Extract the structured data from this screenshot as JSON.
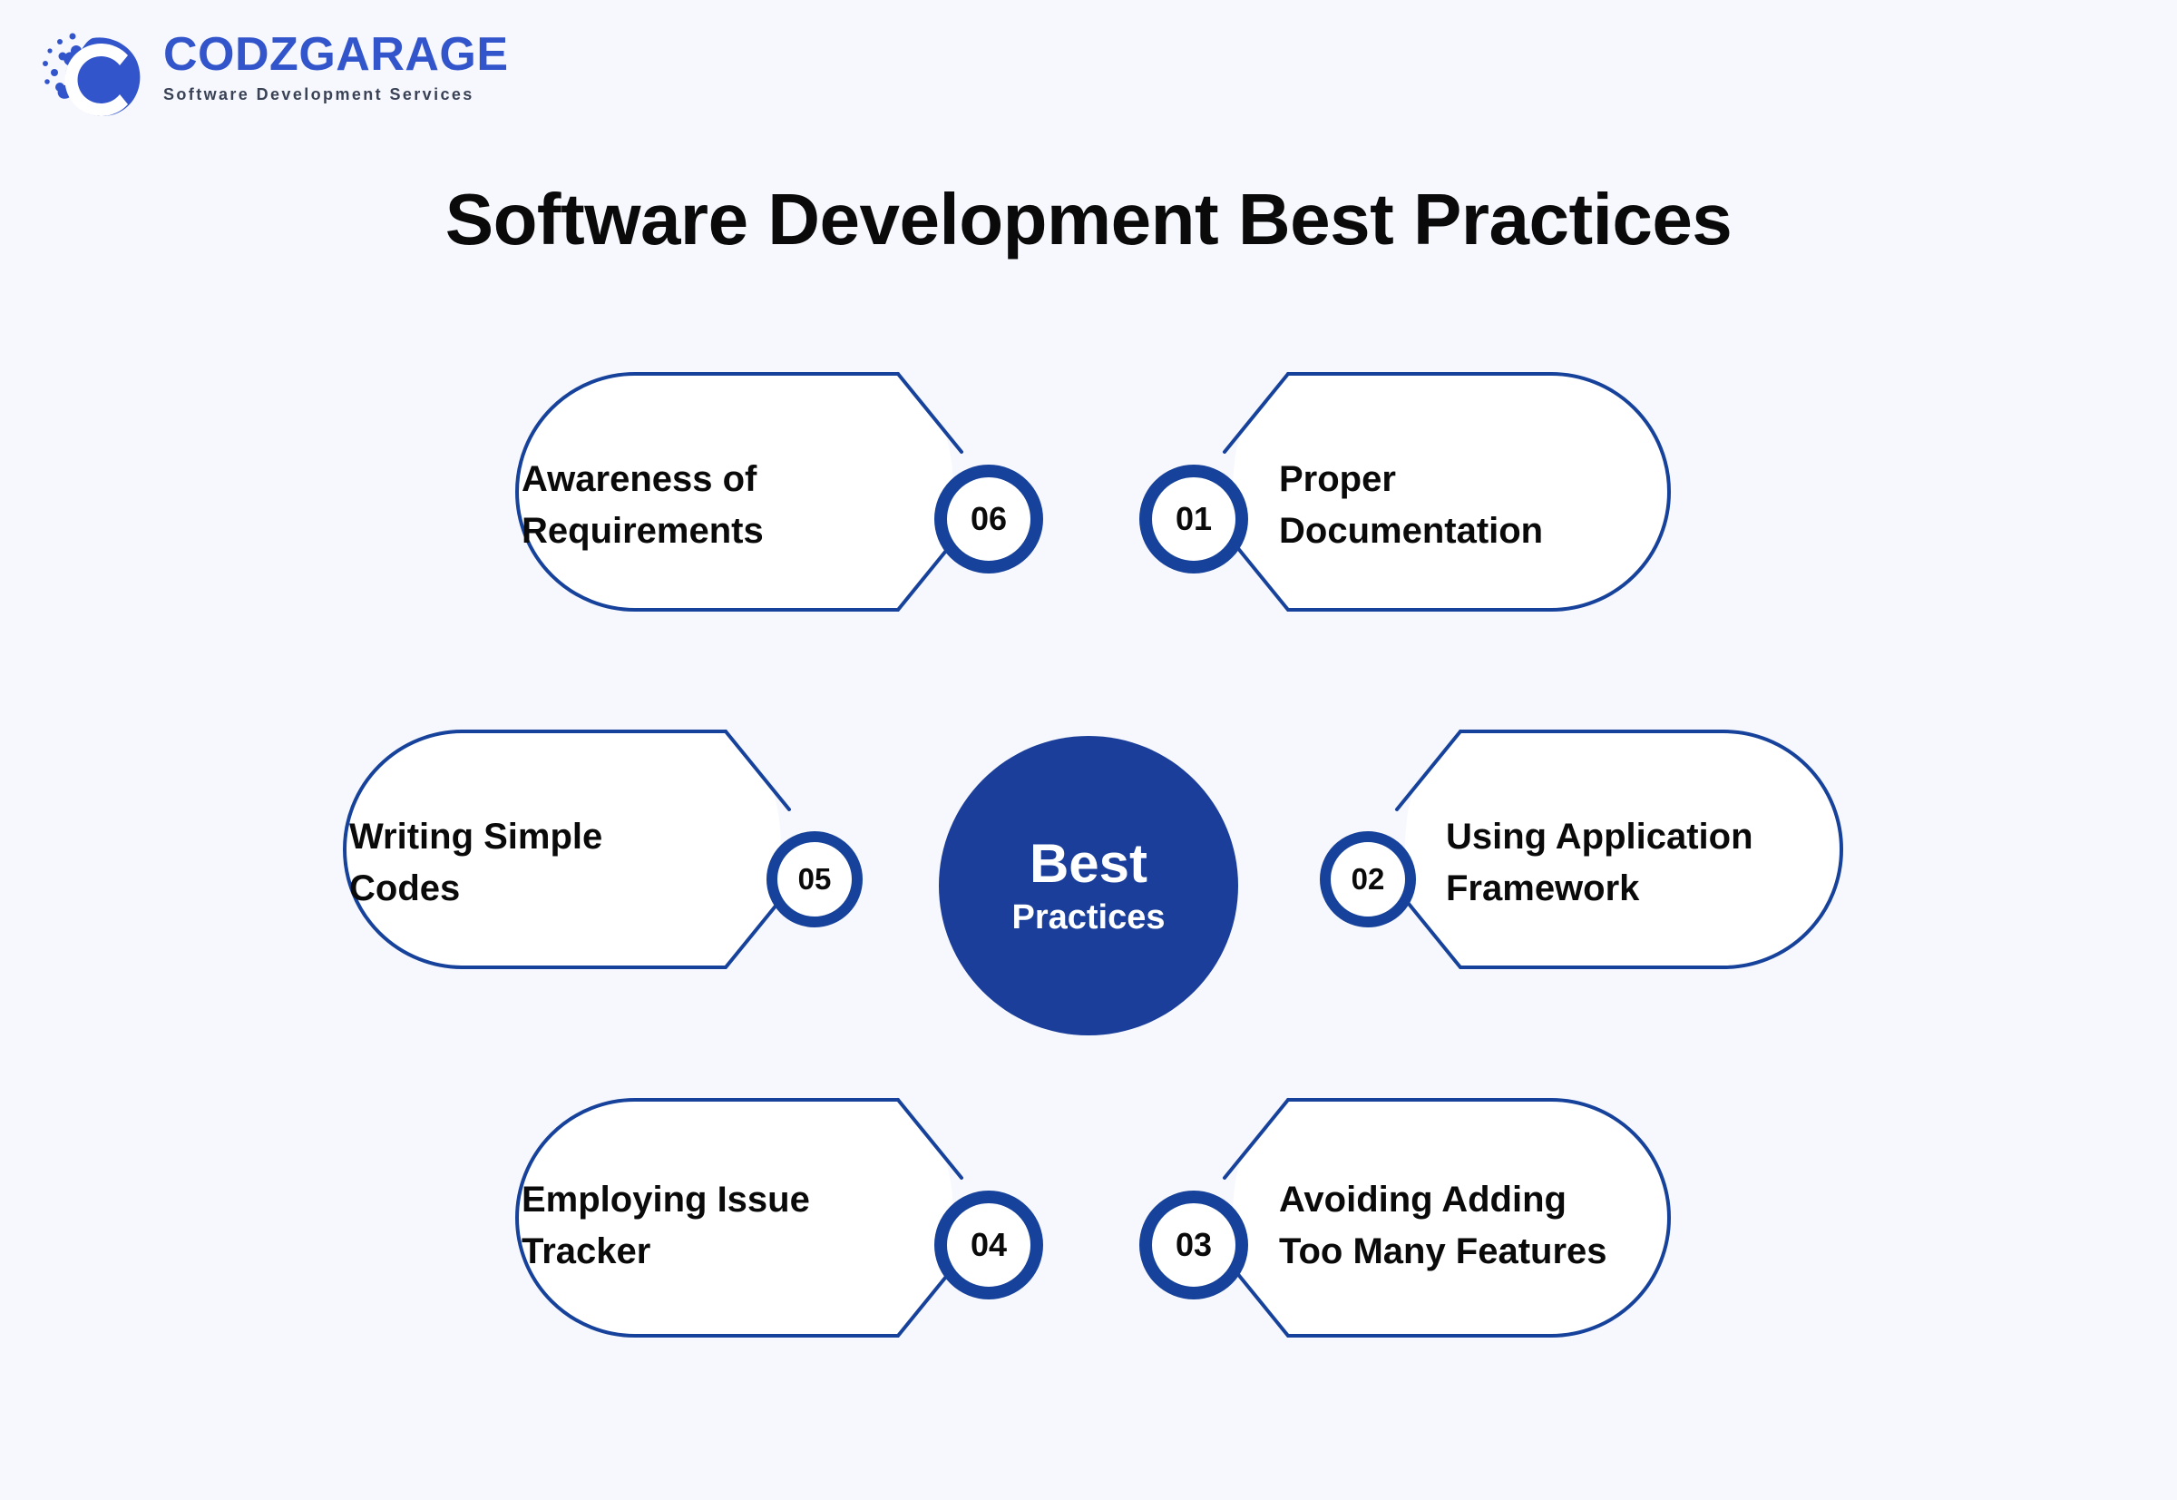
{
  "background_color": "#f6f8fd",
  "brand": {
    "logo_icon": "codzgarage-c-blob-icon",
    "wordmark": "CODZGARAGE",
    "tagline": "Software Development Services",
    "wordmark_color": "#3355cc",
    "tagline_color": "#3a4256"
  },
  "header": {
    "title": "Software Development Best Practices"
  },
  "center": {
    "title": "Best",
    "subtitle": "Practices",
    "fill_color": "#1a3e99",
    "text_color": "#ffffff"
  },
  "theme": {
    "card_border_color": "#17429b",
    "card_fill_color": "#ffffff",
    "badge_ring_color": "#17429b",
    "label_color": "#0a0a0a"
  },
  "cards": [
    {
      "number": "06",
      "label": "Awareness of\nRequirements",
      "side": "left",
      "row": "top"
    },
    {
      "number": "01",
      "label": "Proper\nDocumentation",
      "side": "right",
      "row": "top"
    },
    {
      "number": "05",
      "label": "Writing Simple\nCodes",
      "side": "left",
      "row": "middle"
    },
    {
      "number": "02",
      "label": "Using Application\nFramework",
      "side": "right",
      "row": "middle"
    },
    {
      "number": "04",
      "label": "Employing Issue\nTracker",
      "side": "left",
      "row": "bottom"
    },
    {
      "number": "03",
      "label": "Avoiding Adding\nToo Many Features",
      "side": "right",
      "row": "bottom"
    }
  ]
}
